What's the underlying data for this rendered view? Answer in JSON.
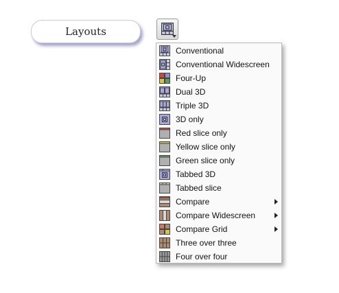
{
  "header": {
    "layouts_label": "Layouts"
  },
  "layout_button": {
    "icon": "layout-conventional-icon"
  },
  "menu": {
    "items": [
      {
        "label": "Conventional",
        "icon": "conventional-icon",
        "submenu": false
      },
      {
        "label": "Conventional Widescreen",
        "icon": "conventional-widescreen-icon",
        "submenu": false
      },
      {
        "label": "Four-Up",
        "icon": "four-up-icon",
        "submenu": false
      },
      {
        "label": "Dual 3D",
        "icon": "dual-3d-icon",
        "submenu": false
      },
      {
        "label": "Triple 3D",
        "icon": "triple-3d-icon",
        "submenu": false
      },
      {
        "label": "3D only",
        "icon": "3d-only-icon",
        "submenu": false
      },
      {
        "label": "Red slice only",
        "icon": "red-slice-icon",
        "submenu": false
      },
      {
        "label": "Yellow slice only",
        "icon": "yellow-slice-icon",
        "submenu": false
      },
      {
        "label": "Green slice only",
        "icon": "green-slice-icon",
        "submenu": false
      },
      {
        "label": "Tabbed 3D",
        "icon": "tabbed-3d-icon",
        "submenu": false
      },
      {
        "label": "Tabbed slice",
        "icon": "tabbed-slice-icon",
        "submenu": false
      },
      {
        "label": "Compare",
        "icon": "compare-icon",
        "submenu": true
      },
      {
        "label": "Compare Widescreen",
        "icon": "compare-widescreen-icon",
        "submenu": true
      },
      {
        "label": "Compare Grid",
        "icon": "compare-grid-icon",
        "submenu": true
      },
      {
        "label": "Three over three",
        "icon": "three-over-three-icon",
        "submenu": false
      },
      {
        "label": "Four over four",
        "icon": "four-over-four-icon",
        "submenu": false
      }
    ]
  },
  "colors": {
    "red_slice": "#c94a3f",
    "yellow_slice": "#d8c44a",
    "green_slice": "#5f9a5a",
    "view_3d": "#8e8ed0",
    "slice_gray": "#a8a8a8"
  }
}
